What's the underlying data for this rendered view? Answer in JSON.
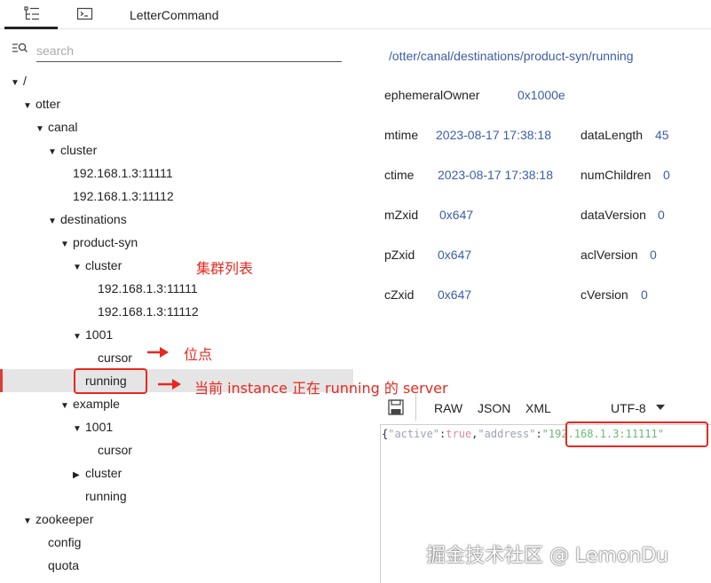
{
  "tabs": {
    "icons": [
      "tree-icon",
      "terminal-icon"
    ],
    "label": "LetterCommand"
  },
  "search": {
    "placeholder": "search",
    "value": ""
  },
  "tree": [
    {
      "label": "/",
      "caret": "down"
    },
    {
      "label": "otter",
      "caret": "down"
    },
    {
      "label": "canal",
      "caret": "down"
    },
    {
      "label": "cluster",
      "caret": "down"
    },
    {
      "label": "192.168.1.3:11111",
      "caret": "none"
    },
    {
      "label": "192.168.1.3:11112",
      "caret": "none"
    },
    {
      "label": "destinations",
      "caret": "down"
    },
    {
      "label": "product-syn",
      "caret": "down"
    },
    {
      "label": "cluster",
      "caret": "down"
    },
    {
      "label": "192.168.1.3:11111",
      "caret": "none"
    },
    {
      "label": "192.168.1.3:11112",
      "caret": "none"
    },
    {
      "label": "1001",
      "caret": "down"
    },
    {
      "label": "cursor",
      "caret": "none"
    },
    {
      "label": "running",
      "caret": "none",
      "selected": true
    },
    {
      "label": "example",
      "caret": "down"
    },
    {
      "label": "1001",
      "caret": "down"
    },
    {
      "label": "cursor",
      "caret": "none"
    },
    {
      "label": "cluster",
      "caret": "right"
    },
    {
      "label": "running",
      "caret": "none"
    },
    {
      "label": "zookeeper",
      "caret": "down"
    },
    {
      "label": "config",
      "caret": "none"
    },
    {
      "label": "quota",
      "caret": "none"
    }
  ],
  "annotations": {
    "cluster_list": "集群列表",
    "position": "位点",
    "running_server": "当前 instance 正在 running 的 server",
    "color": "#e8281f"
  },
  "node": {
    "path": "/otter/canal/destinations/product-syn/running",
    "ephemeralOwner": {
      "key": "ephemeralOwner",
      "value": "0x1000e"
    },
    "mtime": {
      "key": "mtime",
      "value": "2023-08-17 17:38:18"
    },
    "ctime": {
      "key": "ctime",
      "value": "2023-08-17 17:38:18"
    },
    "mZxid": {
      "key": "mZxid",
      "value": "0x647"
    },
    "pZxid": {
      "key": "pZxid",
      "value": "0x647"
    },
    "cZxid": {
      "key": "cZxid",
      "value": "0x647"
    },
    "dataLength": {
      "key": "dataLength",
      "value": "45"
    },
    "numChildren": {
      "key": "numChildren",
      "value": "0"
    },
    "dataVersion": {
      "key": "dataVersion",
      "value": "0"
    },
    "aclVersion": {
      "key": "aclVersion",
      "value": "0"
    },
    "cVersion": {
      "key": "cVersion",
      "value": "0"
    }
  },
  "editor": {
    "formats": [
      "RAW",
      "JSON",
      "XML"
    ],
    "encoding": "UTF-8",
    "content": {
      "open": "{",
      "key1": "\"active\"",
      "colon": ":",
      "val1": "true",
      "comma": ",",
      "key2": "\"address\"",
      "val2": "\"192.168.1.3:11111\""
    }
  },
  "watermark": "掘金技术社区 @ LemonDu"
}
